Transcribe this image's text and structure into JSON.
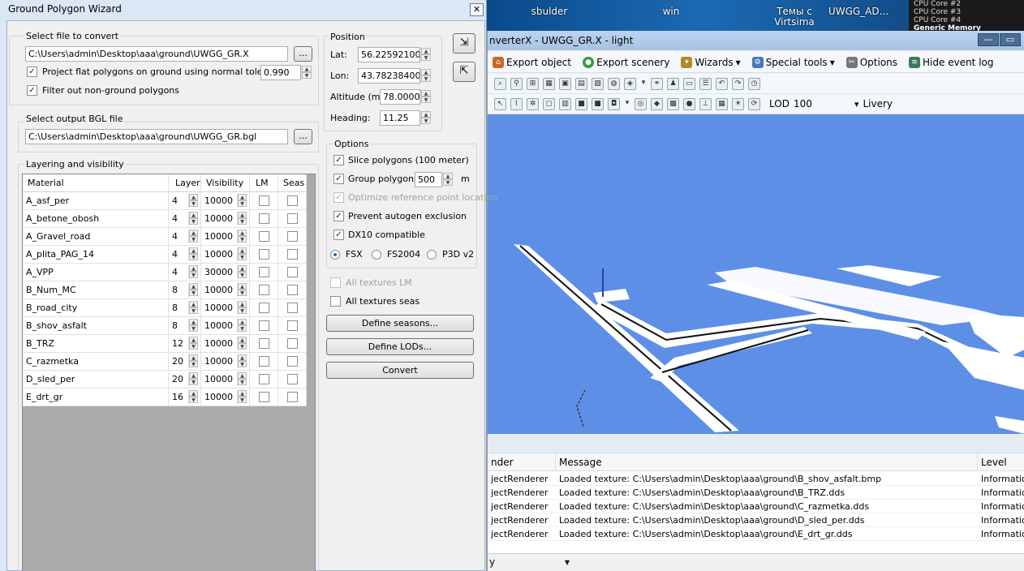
{
  "desktop": {
    "icons": [
      "sbulder",
      "win",
      "Темы с Virtsima",
      "UWGG_AD..."
    ],
    "gadget": [
      "CPU Core #2",
      "CPU Core #3",
      "CPU Core #4",
      "Generic Memory"
    ]
  },
  "app": {
    "title": "nverterX - UWGG_GR.X - light",
    "window_buttons": [
      "—",
      "▭"
    ],
    "menu": [
      {
        "label": "Export object",
        "icon": "export-icon"
      },
      {
        "label": "Export scenery",
        "icon": "globe-icon"
      },
      {
        "label": "Wizards",
        "icon": "wand-icon"
      },
      {
        "label": "Special tools",
        "icon": "gear-icon"
      },
      {
        "label": "Options",
        "icon": "tools-icon"
      },
      {
        "label": "Hide event log",
        "icon": "log-icon"
      }
    ],
    "lod_label": "LOD",
    "lod_value": "100",
    "livery_label": "Livery",
    "log": {
      "columns": [
        "nder",
        "Message",
        "Level"
      ],
      "rows": [
        {
          "sender": "jectRenderer",
          "message": "Loaded texture: C:\\Users\\admin\\Desktop\\aaa\\ground\\B_shov_asfalt.bmp",
          "level": "Information"
        },
        {
          "sender": "jectRenderer",
          "message": "Loaded texture: C:\\Users\\admin\\Desktop\\aaa\\ground\\B_TRZ.dds",
          "level": "Information"
        },
        {
          "sender": "jectRenderer",
          "message": "Loaded texture: C:\\Users\\admin\\Desktop\\aaa\\ground\\C_razmetka.dds",
          "level": "Information"
        },
        {
          "sender": "jectRenderer",
          "message": "Loaded texture: C:\\Users\\admin\\Desktop\\aaa\\ground\\D_sled_per.dds",
          "level": "Information"
        },
        {
          "sender": "jectRenderer",
          "message": "Loaded texture: C:\\Users\\admin\\Desktop\\aaa\\ground\\E_drt_gr.dds",
          "level": "Information"
        }
      ],
      "filter_value": "y"
    }
  },
  "wizard": {
    "title": "Ground Polygon Wizard",
    "close": "✕",
    "select_file_label": "Select file to convert",
    "input_file": "C:\\Users\\admin\\Desktop\\aaa\\ground\\UWGG_GR.X",
    "browse": "...",
    "project_flat_label": "Project flat polygons on ground using normal tolerance:",
    "tolerance": "0.990",
    "filter_label": "Filter out non-ground polygons",
    "select_output_label": "Select output BGL file",
    "output_file": "C:\\Users\\admin\\Desktop\\aaa\\ground\\UWGG_GR.bgl",
    "position_label": "Position",
    "lat_label": "Lat:",
    "lat": "56.22592100",
    "lon_label": "Lon:",
    "lon": "43.78238400",
    "alt_label": "Altitude (m):",
    "alt": "78.0000",
    "heading_label": "Heading:",
    "heading": "11.25",
    "options_label": "Options",
    "slice_label": "Slice polygons (100 meter)",
    "group_label": "Group polygons",
    "group_value": "500",
    "group_unit": "m",
    "optimize_label": "Optimize reference point location",
    "prevent_label": "Prevent autogen exclusion",
    "dx10_label": "DX10 compatible",
    "sim_options": [
      "FSX",
      "FS2004",
      "P3D v2"
    ],
    "all_lm_label": "All textures LM",
    "all_seas_label": "All textures seas",
    "define_seasons": "Define seasons...",
    "define_lods": "Define LODs...",
    "convert": "Convert",
    "layering_label": "Layering and visibility",
    "grid_columns": [
      "Material",
      "Layer",
      "Visibility",
      "LM",
      "Seas"
    ],
    "materials": [
      {
        "name": "A_asf_per",
        "layer": "4",
        "vis": "10000"
      },
      {
        "name": "A_betone_obosh",
        "layer": "4",
        "vis": "10000"
      },
      {
        "name": "A_Gravel_road",
        "layer": "4",
        "vis": "10000"
      },
      {
        "name": "A_plita_PAG_14",
        "layer": "4",
        "vis": "10000"
      },
      {
        "name": "A_VPP",
        "layer": "4",
        "vis": "30000"
      },
      {
        "name": "B_Num_MC",
        "layer": "8",
        "vis": "10000"
      },
      {
        "name": "B_road_city",
        "layer": "8",
        "vis": "10000"
      },
      {
        "name": "B_shov_asfalt",
        "layer": "8",
        "vis": "10000"
      },
      {
        "name": "B_TRZ",
        "layer": "12",
        "vis": "10000"
      },
      {
        "name": "C_razmetka",
        "layer": "20",
        "vis": "10000"
      },
      {
        "name": "D_sled_per",
        "layer": "20",
        "vis": "10000"
      },
      {
        "name": "E_drt_gr",
        "layer": "16",
        "vis": "10000"
      }
    ]
  }
}
